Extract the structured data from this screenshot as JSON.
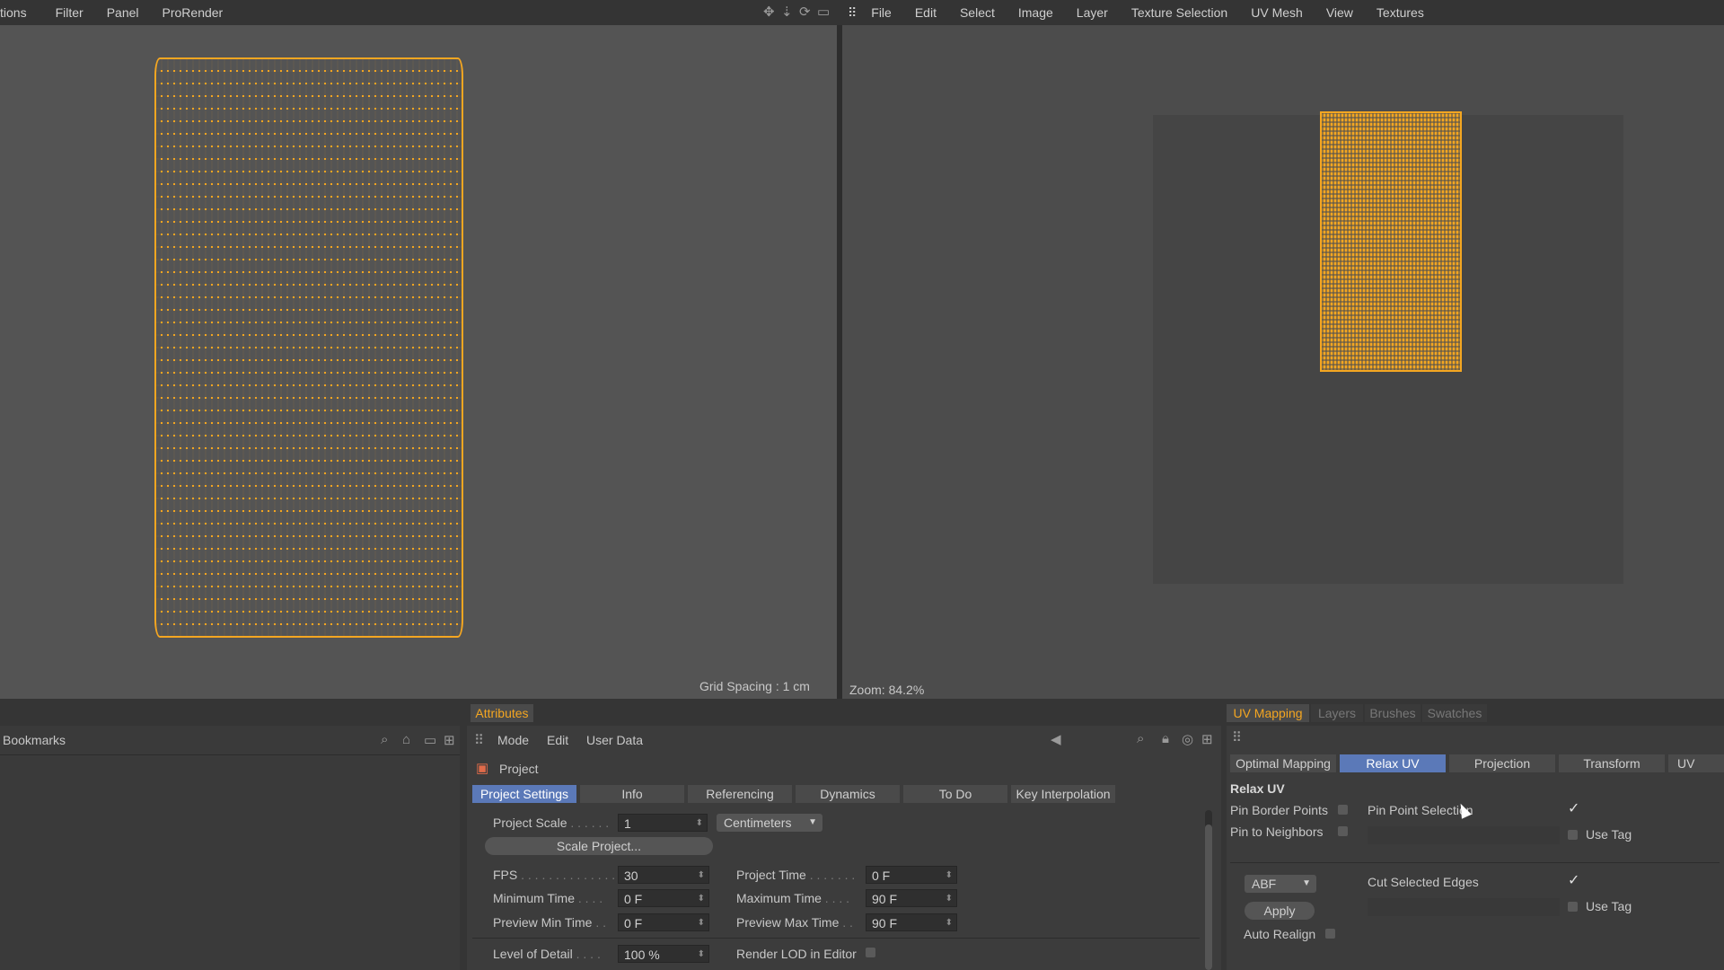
{
  "left_menu": [
    "tions",
    "Filter",
    "Panel",
    "ProRender"
  ],
  "right_menu": [
    "File",
    "Edit",
    "Select",
    "Image",
    "Layer",
    "Texture Selection",
    "UV Mesh",
    "View",
    "Textures"
  ],
  "viewport": {
    "grid_spacing": "Grid Spacing : 1 cm"
  },
  "uv_view": {
    "zoom": "Zoom: 84.2%"
  },
  "bookmarks": {
    "title": "Bookmarks"
  },
  "attributes": {
    "tab": "Attributes",
    "menu": [
      "Mode",
      "Edit",
      "User Data"
    ],
    "object": "Project",
    "subtabs": [
      "Project Settings",
      "Info",
      "Referencing",
      "Dynamics",
      "To Do",
      "Key Interpolation"
    ],
    "project_scale_label": "Project Scale",
    "project_scale_value": "1",
    "unit": "Centimeters",
    "scale_button": "Scale Project...",
    "fps_label": "FPS",
    "fps_value": "30",
    "project_time_label": "Project Time",
    "project_time_value": "0 F",
    "min_time_label": "Minimum Time",
    "min_time_value": "0 F",
    "max_time_label": "Maximum Time",
    "max_time_value": "90 F",
    "prev_min_label": "Preview Min Time",
    "prev_min_value": "0 F",
    "prev_max_label": "Preview Max Time",
    "prev_max_value": "90 F",
    "lod_label": "Level of Detail",
    "lod_value": "100 %",
    "render_lod_label": "Render LOD in Editor"
  },
  "uv_panel": {
    "tabs": [
      "UV Mapping",
      "Layers",
      "Brushes",
      "Swatches"
    ],
    "subtabs": [
      "Optimal Mapping",
      "Relax UV",
      "Projection",
      "Transform",
      "UV Comm"
    ],
    "section": "Relax UV",
    "pin_border": "Pin Border Points",
    "pin_neighbors": "Pin to Neighbors",
    "pin_point_selection": "Pin Point Selection",
    "use_tag": "Use Tag",
    "method": "ABF",
    "cut_edges": "Cut Selected Edges",
    "use_tag_2": "Use Tag",
    "apply": "Apply",
    "auto_realign": "Auto Realign"
  }
}
